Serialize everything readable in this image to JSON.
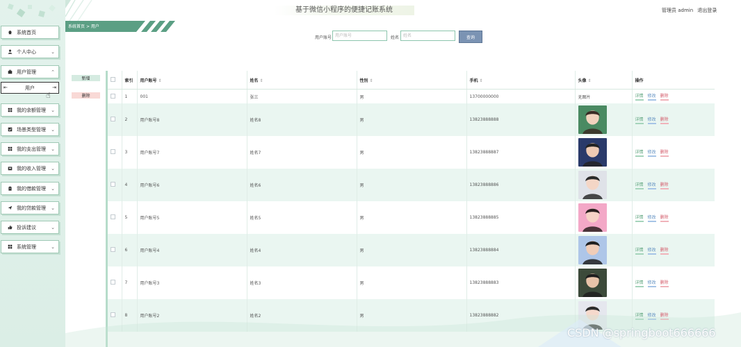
{
  "app": {
    "title": "基于微信小程序的便捷记账系统",
    "user_label": "管理员 admin",
    "logout_label": "退出登录"
  },
  "breadcrumb": {
    "home": "系统首页",
    "separator": ">",
    "current": "用户"
  },
  "sidebar": {
    "items": [
      {
        "label": "系统首页",
        "icon": "home-icon",
        "chevron": ""
      },
      {
        "label": "个人中心",
        "icon": "person-icon",
        "chevron": "⌄"
      },
      {
        "label": "用户管理",
        "icon": "briefcase-icon",
        "chevron": "⌃"
      },
      {
        "label": "我的余额管理",
        "icon": "grid-icon",
        "chevron": "⌄"
      },
      {
        "label": "场景类型管理",
        "icon": "check-box-icon",
        "chevron": "⌄"
      },
      {
        "label": "我的支出管理",
        "icon": "grid-icon",
        "chevron": "⌄"
      },
      {
        "label": "我的收入管理",
        "icon": "inbox-icon",
        "chevron": "⌄"
      },
      {
        "label": "我的借款管理",
        "icon": "clipboard-icon",
        "chevron": "⌄"
      },
      {
        "label": "我的贷款管理",
        "icon": "send-icon",
        "chevron": "⌄"
      },
      {
        "label": "投诉建议",
        "icon": "thumbs-up-icon",
        "chevron": "⌄"
      },
      {
        "label": "系统管理",
        "icon": "grid-icon",
        "chevron": "⌄"
      }
    ],
    "submenu_active": "用户"
  },
  "search": {
    "account_label": "用户账号",
    "account_placeholder": "用户账号",
    "name_label": "姓名",
    "name_placeholder": "姓名",
    "button_label": "查询"
  },
  "actions": {
    "add_label": "新增",
    "delete_label": "删除"
  },
  "table": {
    "headers": {
      "index": "索引",
      "account": "用户账号",
      "name": "姓名",
      "gender": "性别",
      "phone": "手机",
      "avatar": "头像",
      "ops": "操作"
    },
    "ops": {
      "detail": "详情",
      "edit": "修改",
      "delete": "删除"
    },
    "no_image_text": "无图片",
    "rows": [
      {
        "index": "1",
        "account": "001",
        "name": "张三",
        "gender": "男",
        "phone": "13700000000",
        "avatar": "none"
      },
      {
        "index": "2",
        "account": "用户账号8",
        "name": "姓名8",
        "gender": "男",
        "phone": "13823888888",
        "avatar": "photo"
      },
      {
        "index": "3",
        "account": "用户账号7",
        "name": "姓名7",
        "gender": "男",
        "phone": "13823888887",
        "avatar": "photo"
      },
      {
        "index": "4",
        "account": "用户账号6",
        "name": "姓名6",
        "gender": "男",
        "phone": "13823888886",
        "avatar": "photo"
      },
      {
        "index": "5",
        "account": "用户账号5",
        "name": "姓名5",
        "gender": "男",
        "phone": "13823888885",
        "avatar": "photo"
      },
      {
        "index": "6",
        "account": "用户账号4",
        "name": "姓名4",
        "gender": "男",
        "phone": "13823888884",
        "avatar": "photo"
      },
      {
        "index": "7",
        "account": "用户账号3",
        "name": "姓名3",
        "gender": "男",
        "phone": "13823888883",
        "avatar": "photo"
      },
      {
        "index": "8",
        "account": "用户账号2",
        "name": "姓名2",
        "gender": "男",
        "phone": "13823888882",
        "avatar": "photo"
      }
    ]
  },
  "watermark": "CSDN @springboot666666",
  "colors": {
    "accent": "#5b9f84",
    "sidebar_bg": "#e3f2ec",
    "row_alt": "#eaf6f1",
    "detail": "#5aa27a",
    "edit": "#5f8fc0",
    "delete": "#d35c6a",
    "search_button": "#7b93b3",
    "add_button_bg": "#d5ebe1",
    "delete_button_bg": "#f9d9d6"
  }
}
